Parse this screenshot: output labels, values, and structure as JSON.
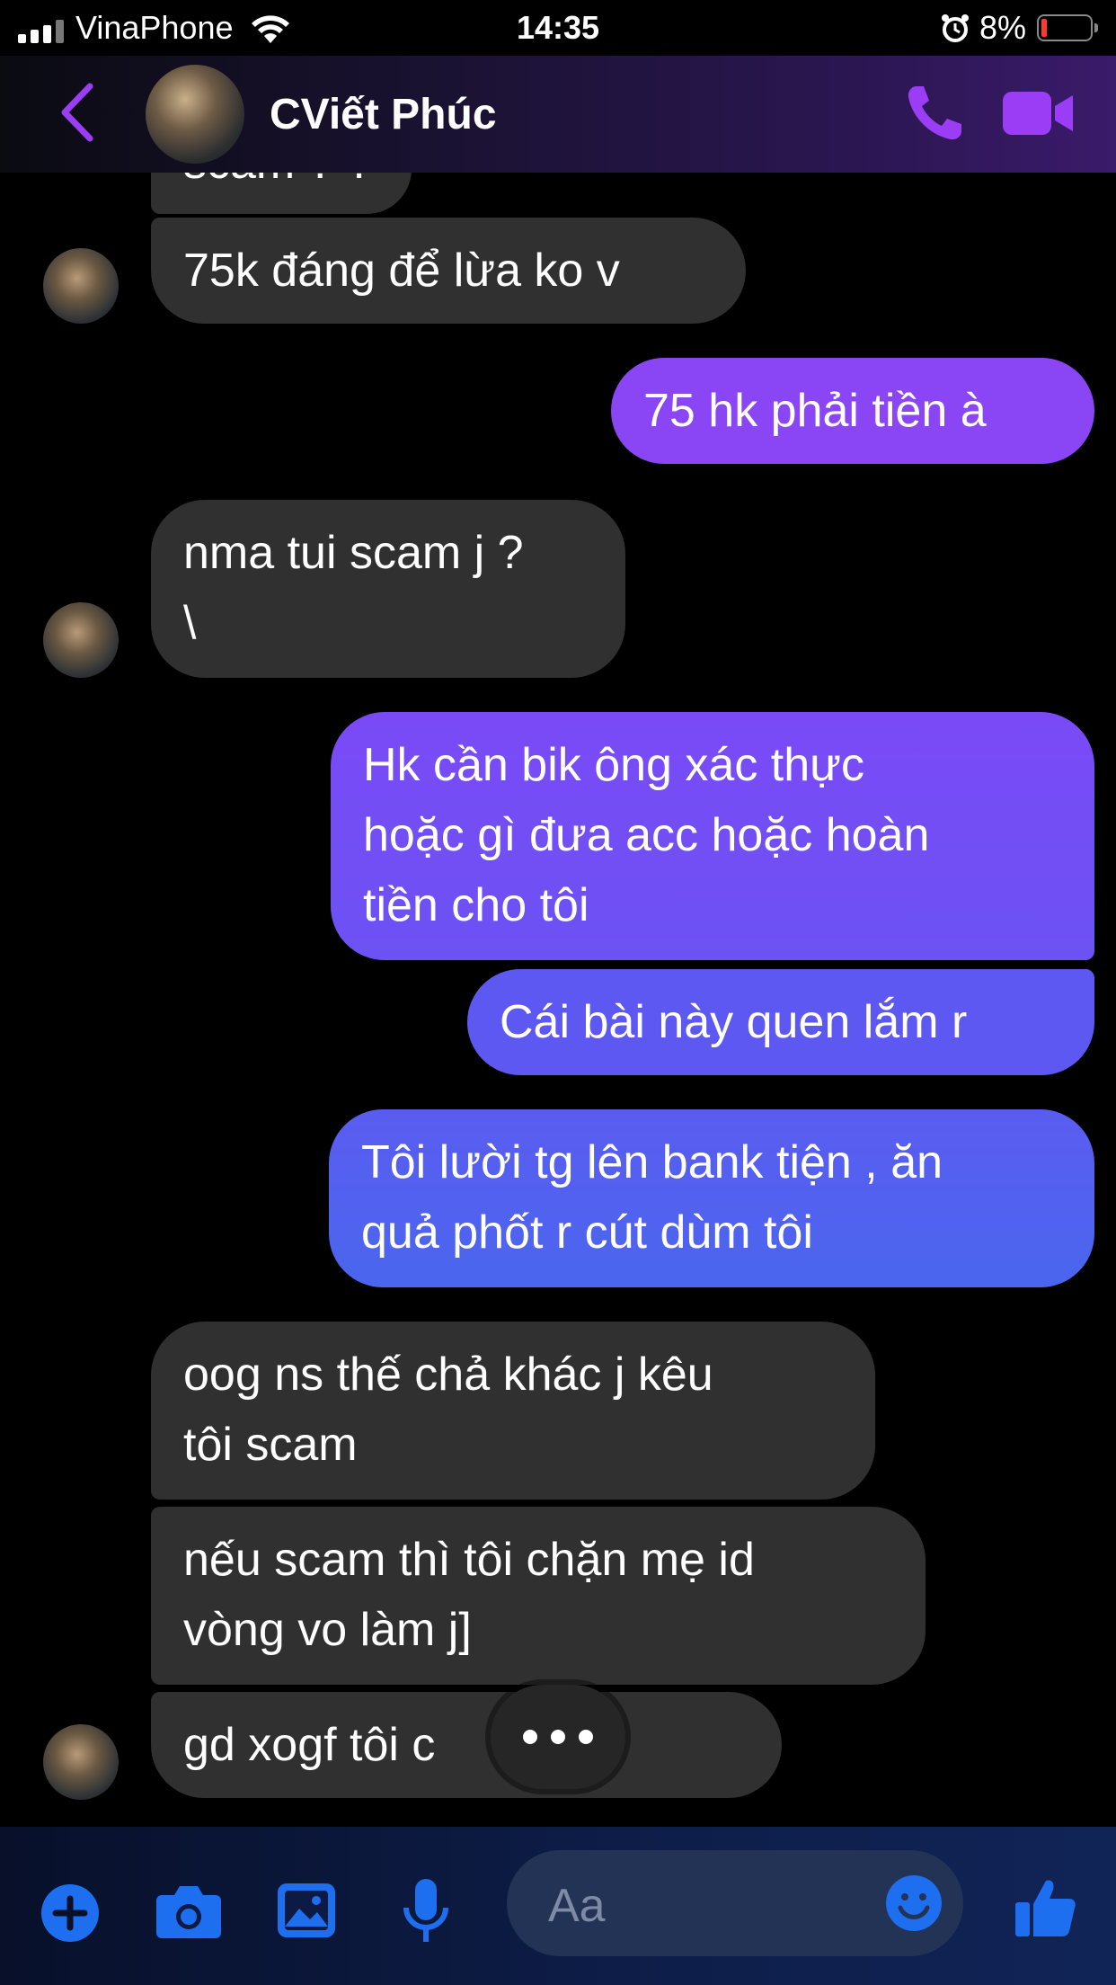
{
  "status_bar": {
    "carrier": "VinaPhone",
    "time": "14:35",
    "battery_percent": "8%"
  },
  "header": {
    "contact_name": "CViết Phúc"
  },
  "messages": [
    {
      "text": "scam ? ?"
    },
    {
      "text": "75k đáng để lừa ko v"
    },
    {
      "text": "75 hk phải tiền à"
    },
    {
      "text": "nma tui scam j ?\n\\"
    },
    {
      "text": "Hk cần bik ông xác thực\nhoặc gì đưa acc hoặc hoàn\ntiền cho tôi"
    },
    {
      "text": "Cái bài này quen lắm r"
    },
    {
      "text": "Tôi lười tg lên bank tiện , ăn\nquả phốt r cút dùm tôi"
    },
    {
      "text": "oog ns thế chả khác j kêu\ntôi scam"
    },
    {
      "text": "nếu scam thì tôi chặn mẹ id\nvòng vo làm j]"
    },
    {
      "text": "gd xogf tôi c     oàn b"
    }
  ],
  "composer": {
    "placeholder": "Aa"
  },
  "colors": {
    "accent": "#9a3df5",
    "composer_icons": "#1e6ff0",
    "incoming_bubble": "#303030"
  },
  "icons": [
    "back-chevron-icon",
    "phone-icon",
    "video-camera-icon",
    "plus-icon",
    "camera-icon",
    "image-icon",
    "microphone-icon",
    "smiley-icon",
    "thumbs-up-icon"
  ]
}
